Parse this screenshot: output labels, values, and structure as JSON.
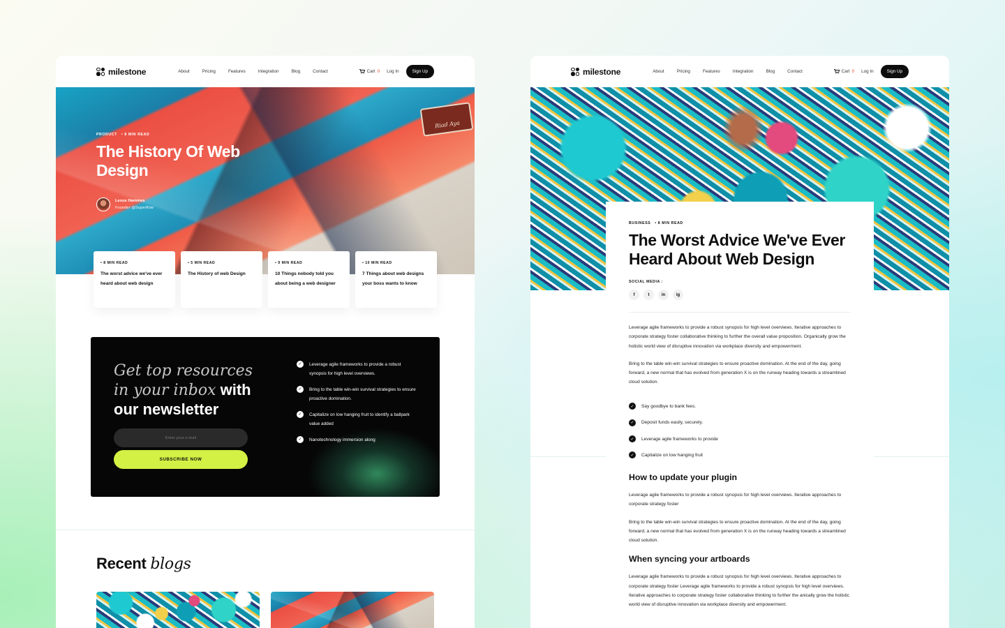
{
  "nav": {
    "brand": "milestone",
    "links": [
      "About",
      "Pricing",
      "Features",
      "Integration",
      "Blog",
      "Contact"
    ],
    "cart_label": "Cart",
    "cart_count": "0",
    "login": "Log In",
    "signup": "Sign Up"
  },
  "left": {
    "hero": {
      "category": "PRODUCT",
      "read_time": "• 8 MIN READ",
      "title": "The History Of Web Design",
      "sign_text": "Riad Aya",
      "author_name": "Lexus Hammes",
      "author_role": "Founder @Superflow"
    },
    "mini_cards": [
      {
        "meta": "• 8 MIN READ",
        "title": "The worst advice we've ever heard about web design"
      },
      {
        "meta": "• 5 MIN READ",
        "title": "The History of web Design"
      },
      {
        "meta": "• 9 MIN READ",
        "title": "10 Things nobody told you about being a web designer"
      },
      {
        "meta": "• 10 MIN READ",
        "title": "7 Things about web designs your boss wants to know"
      }
    ],
    "newsletter": {
      "title_italic": "Get top resources in your inbox",
      "title_bold": "with our newsletter",
      "email_placeholder": "Enter your e-mail",
      "button": "SUBSCRIBE NOW",
      "items": [
        "Leverage agile frameworks to provide a robust synopsis for high level overviews.",
        "Bring to the table win-win survival strategies to ensure proactive domination.",
        "Capitalize on low hanging fruit to identify a ballpark value added",
        "Nanotechnology immersion along"
      ]
    },
    "recent": {
      "bold": "Recent",
      "italic": "blogs"
    }
  },
  "right": {
    "article": {
      "category": "BUSINESS",
      "read_time": "• 8 MIN READ",
      "title": "The Worst Advice We've Ever Heard About Web Design",
      "social_label": "SOCIAL MEDIA :",
      "social_icons": [
        "f",
        "t",
        "in",
        "ig"
      ],
      "p1": "Leverage agile frameworks to provide a robust synopsis for high level overviews. Iterative approaches to corporate strategy foster collaborative thinking to further the overall value proposition. Organically grow the holistic world view of disruptive innovation via workplace diversity and empowerment.",
      "p2": "Bring to the table win-win survival strategies to ensure proactive domination. At the end of the day, going forward, a new normal that has evolved from generation X is on the runway heading towards a streamlined cloud solution.",
      "bullets": [
        "Say goodbye to bank fees.",
        "Deposit funds easily, securely.",
        "Leverage agile frameworks to provide",
        "Capitalize on low hanging fruit"
      ],
      "h_plugin": "How to update your plugin",
      "p3": "Leverage agile frameworks to provide a robust synopsis for high level overviews. Iterative approaches to corporate strategy foster",
      "p4": "Bring to the table win-win survival strategies to ensure proactive domination. At the end of the day, going forward, a new normal that has evolved from generation X is on the runway heading towards a streamlined cloud solution.",
      "h_sync": "When syncing your artboards",
      "p5": "Leverage agile frameworks to provide a robust synopsis for high level overviews. Iterative approaches to corporate strategy foster Leverage agile frameworks to provide a robust synopsis for high level overviews. Iterative approaches to corporate strategy foster collaborative thinking to further the anically grow the holistic world view of disruptive innovation via workplace diversity and empowerment."
    }
  }
}
